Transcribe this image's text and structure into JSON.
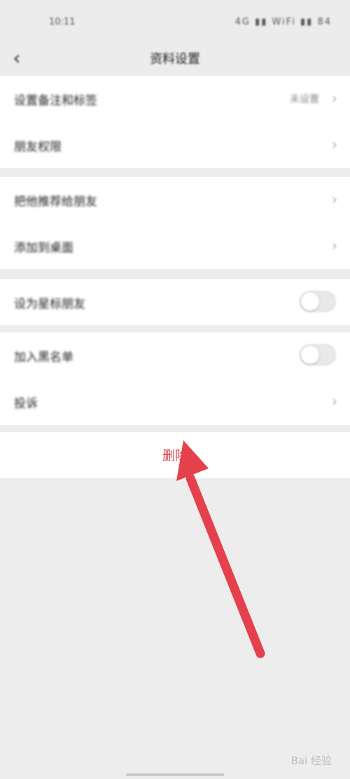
{
  "status_bar": {
    "time": "10:11",
    "icons": "4G ▮▮ WiFi ▮▮ 84"
  },
  "nav": {
    "title": "资料设置"
  },
  "groups": [
    {
      "rows": [
        {
          "label": "设置备注和标签",
          "value": "未设置"
        },
        {
          "label": "朋友权限"
        }
      ]
    },
    {
      "rows": [
        {
          "label": "把他推荐给朋友"
        },
        {
          "label": "添加到桌面"
        }
      ]
    },
    {
      "rows": [
        {
          "label": "设为星标朋友",
          "toggle": false
        }
      ]
    },
    {
      "rows": [
        {
          "label": "加入黑名单",
          "toggle": false
        },
        {
          "label": "投诉"
        }
      ]
    }
  ],
  "delete": {
    "label": "删除"
  },
  "watermark": {
    "text": "Bai 经验"
  },
  "colors": {
    "accent": "#d94545",
    "arrow": "#e5414d",
    "background": "#ededed"
  }
}
